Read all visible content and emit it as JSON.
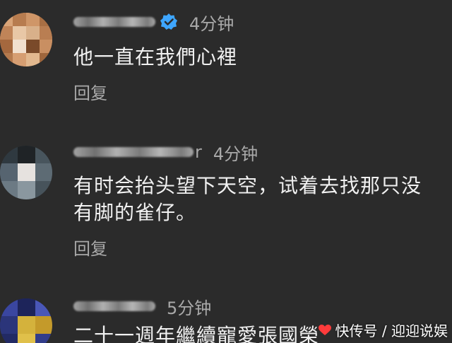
{
  "comments": [
    {
      "username_suffix": "",
      "verified": true,
      "time": "4分钟",
      "lines": [
        "他一直在我們心裡"
      ],
      "reply_label": "回复"
    },
    {
      "username_suffix": "r",
      "verified": false,
      "time": "4分钟",
      "lines": [
        "有时会抬头望下天空，试着去找那只没",
        "有脚的雀仔。"
      ],
      "reply_label": "回复"
    },
    {
      "username_suffix": "",
      "verified": false,
      "time": "5分钟",
      "lines": [
        "二十一週年繼續寵愛張國榮"
      ],
      "reply_label": ""
    }
  ],
  "watermark": {
    "text": "快传号 / 迎迎说娱"
  },
  "colors": {
    "background": "#2b2b2b",
    "text": "#f1f1f1",
    "muted": "#a9a9a9",
    "verified_blue": "#3ea6ff"
  }
}
